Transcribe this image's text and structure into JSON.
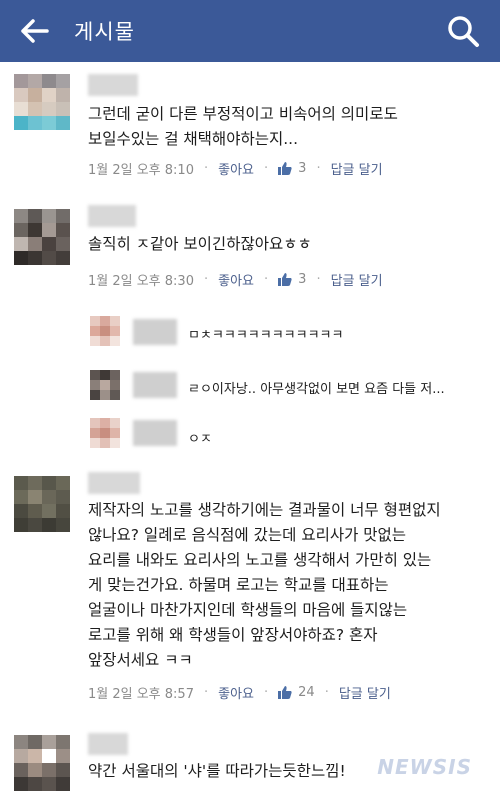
{
  "header": {
    "title": "게시물",
    "back_icon": "back-arrow-icon",
    "search_icon": "search-icon",
    "color": "#3b5998"
  },
  "comments": [
    {
      "text": "그런데 굳이 다른 부정적이고 비속어의 의미로도\n보일수있는 걸 채택해야하는지...",
      "time": "1월 2일 오후 8:10",
      "like_label": "좋아요",
      "like_count": "3",
      "reply_label": "답글 달기"
    },
    {
      "text": "솔직히 ㅈ같아 보이긴하잖아요ㅎㅎ",
      "time": "1월 2일 오후 8:30",
      "like_label": "좋아요",
      "like_count": "3",
      "reply_label": "답글 달기",
      "replies": [
        {
          "text": "ㅁㅊㅋㅋㅋㅋㅋㅋㅋㅋㅋㅋㅋ"
        },
        {
          "text": "ㄹㅇ이자낭.. 아무생각없이 보면 요즘 다들 저..."
        },
        {
          "text": "ㅇㅈ"
        }
      ]
    },
    {
      "text": "제작자의 노고를 생각하기에는 결과물이 너무 형편없지\n않나요? 일례로 음식점에 갔는데 요리사가 맛없는\n요리를 내와도 요리사의 노고를 생각해서 가만히 있는\n게 맞는건가요. 하물며 로고는 학교를 대표하는\n얼굴이나 마찬가지인데 학생들의 마음에 들지않는\n로고를 위해 왜 학생들이 앞장서야하죠? 혼자\n앞장서세요 ㅋㅋ",
      "time": "1월 2일 오후 8:57",
      "like_label": "좋아요",
      "like_count": "24",
      "reply_label": "답글 달기"
    },
    {
      "text": "약간 서울대의 '샤'를 따라가는듯한느낌!"
    }
  ],
  "watermark": "NEWSIS"
}
